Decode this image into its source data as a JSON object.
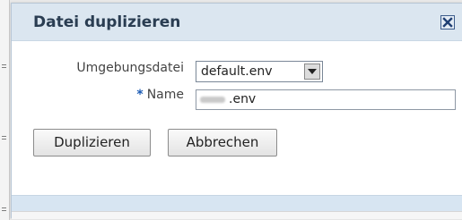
{
  "dialog": {
    "title": "Datei duplizieren",
    "close_icon": "close-x-icon"
  },
  "form": {
    "env_label": "Umgebungsdatei",
    "env_value": "default.env",
    "name_required_marker": "*",
    "name_label": "Name",
    "name_value": ".env"
  },
  "buttons": {
    "duplicate_label": "Duplizieren",
    "cancel_label": "Abbrechen"
  },
  "colors": {
    "titlebar": "#dbe6f0",
    "title_text": "#2a3d52",
    "footer": "#d7e5f2",
    "required_marker": "#1a5ab4"
  }
}
